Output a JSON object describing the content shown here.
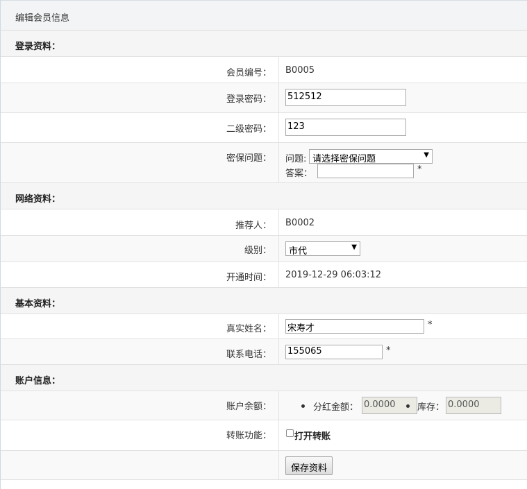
{
  "panel": {
    "title": "编辑会员信息"
  },
  "sections": {
    "login": "登录资料：",
    "network": "网络资料：",
    "basic": "基本资料：",
    "account": "账户信息："
  },
  "member_id": {
    "label": "会员编号：",
    "value": "B0005"
  },
  "login_password": {
    "label": "登录密码：",
    "value": "512512"
  },
  "second_password": {
    "label": "二级密码：",
    "value": "123"
  },
  "security": {
    "label": "密保问题：",
    "question_label": "问题:",
    "question_selected": "请选择密保问题",
    "answer_label": "答案：",
    "answer_value": "",
    "required_mark": "*"
  },
  "referrer": {
    "label": "推荐人：",
    "value": "B0002"
  },
  "level": {
    "label": "级别：",
    "selected": "市代"
  },
  "open_time": {
    "label": "开通时间：",
    "value": "2019-12-29 06:03:12"
  },
  "real_name": {
    "label": "真实姓名：",
    "value": "宋寿才",
    "required_mark": "*"
  },
  "phone": {
    "label": "联系电话：",
    "value": "155065",
    "required_mark": "*"
  },
  "balance": {
    "label": "账户余额：",
    "dividend_label": "分红金额：",
    "dividend_value": "0.0000",
    "stock_label": "库存：",
    "stock_value": "0.0000"
  },
  "transfer": {
    "label": "转账功能：",
    "checkbox_label": "打开转账",
    "checked": false
  },
  "save_button": "保存资料",
  "icons": {
    "dropdown": "triangle-down-icon"
  }
}
